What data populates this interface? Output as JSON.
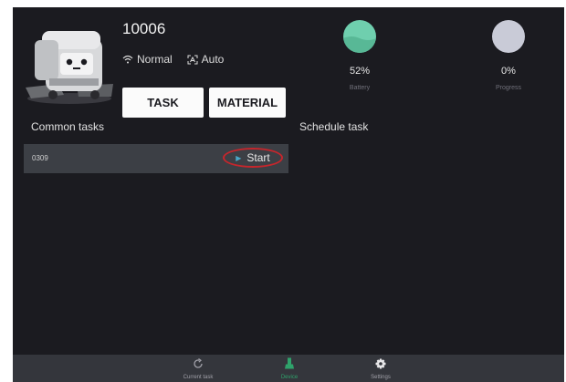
{
  "device": {
    "id": "10006",
    "network_status": "Normal",
    "mode": "Auto"
  },
  "buttons": {
    "task": "TASK",
    "material": "MATERIAL"
  },
  "gauges": {
    "battery": {
      "value": "52%",
      "label": "Battery",
      "color": "#6fcfae",
      "level": 0.52
    },
    "progress": {
      "value": "0%",
      "label": "Progress",
      "color": "#c9cbd7",
      "level": 0
    }
  },
  "sections": {
    "common": "Common tasks",
    "schedule": "Schedule task"
  },
  "tasks": [
    {
      "name": "0309",
      "action": "Start"
    }
  ],
  "nav": {
    "current": "Current task",
    "device": "Device",
    "settings": "Settings",
    "active": "Device",
    "active_color": "#2fa36b"
  },
  "icons": {
    "wifi": "wifi-icon",
    "auto": "auto-mode-icon",
    "play": "play-icon",
    "current_task": "refresh-icon",
    "device": "robot-device-icon",
    "settings": "gear-icon"
  }
}
